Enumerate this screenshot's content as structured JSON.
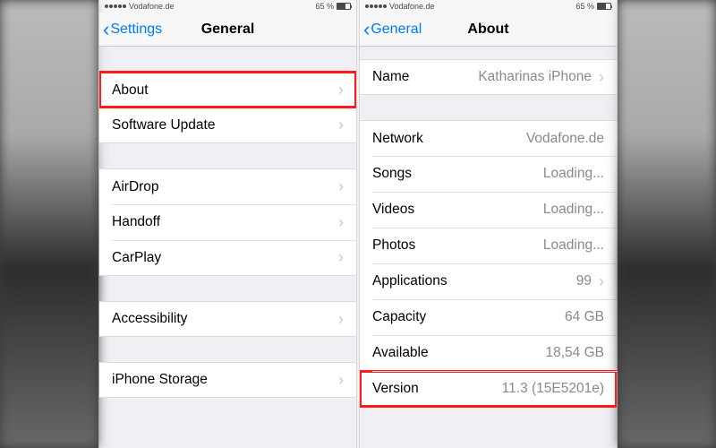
{
  "status": {
    "carrier": "Vodafone.de",
    "time": "",
    "battery": "65 %"
  },
  "left": {
    "back": "Settings",
    "title": "General",
    "groups": [
      {
        "gap": "normal",
        "rows": [
          {
            "label": "About",
            "hl": true
          },
          {
            "label": "Software Update"
          }
        ]
      },
      {
        "gap": "normal",
        "rows": [
          {
            "label": "AirDrop"
          },
          {
            "label": "Handoff"
          },
          {
            "label": "CarPlay"
          }
        ]
      },
      {
        "gap": "normal",
        "rows": [
          {
            "label": "Accessibility"
          }
        ]
      },
      {
        "gap": "normal",
        "rows": [
          {
            "label": "iPhone Storage"
          }
        ]
      }
    ]
  },
  "right": {
    "back": "General",
    "title": "About",
    "groups": [
      {
        "gap": "small",
        "rows": [
          {
            "label": "Name",
            "value": "Katharinas iPhone",
            "disc": true
          }
        ]
      },
      {
        "gap": "normal",
        "rows": [
          {
            "label": "Network",
            "value": "Vodafone.de"
          },
          {
            "label": "Songs",
            "value": "Loading..."
          },
          {
            "label": "Videos",
            "value": "Loading..."
          },
          {
            "label": "Photos",
            "value": "Loading..."
          },
          {
            "label": "Applications",
            "value": "99",
            "disc": true
          },
          {
            "label": "Capacity",
            "value": "64 GB"
          },
          {
            "label": "Available",
            "value": "18,54 GB"
          },
          {
            "label": "Version",
            "value": "11.3 (15E5201e)",
            "hl": true
          }
        ]
      }
    ]
  }
}
